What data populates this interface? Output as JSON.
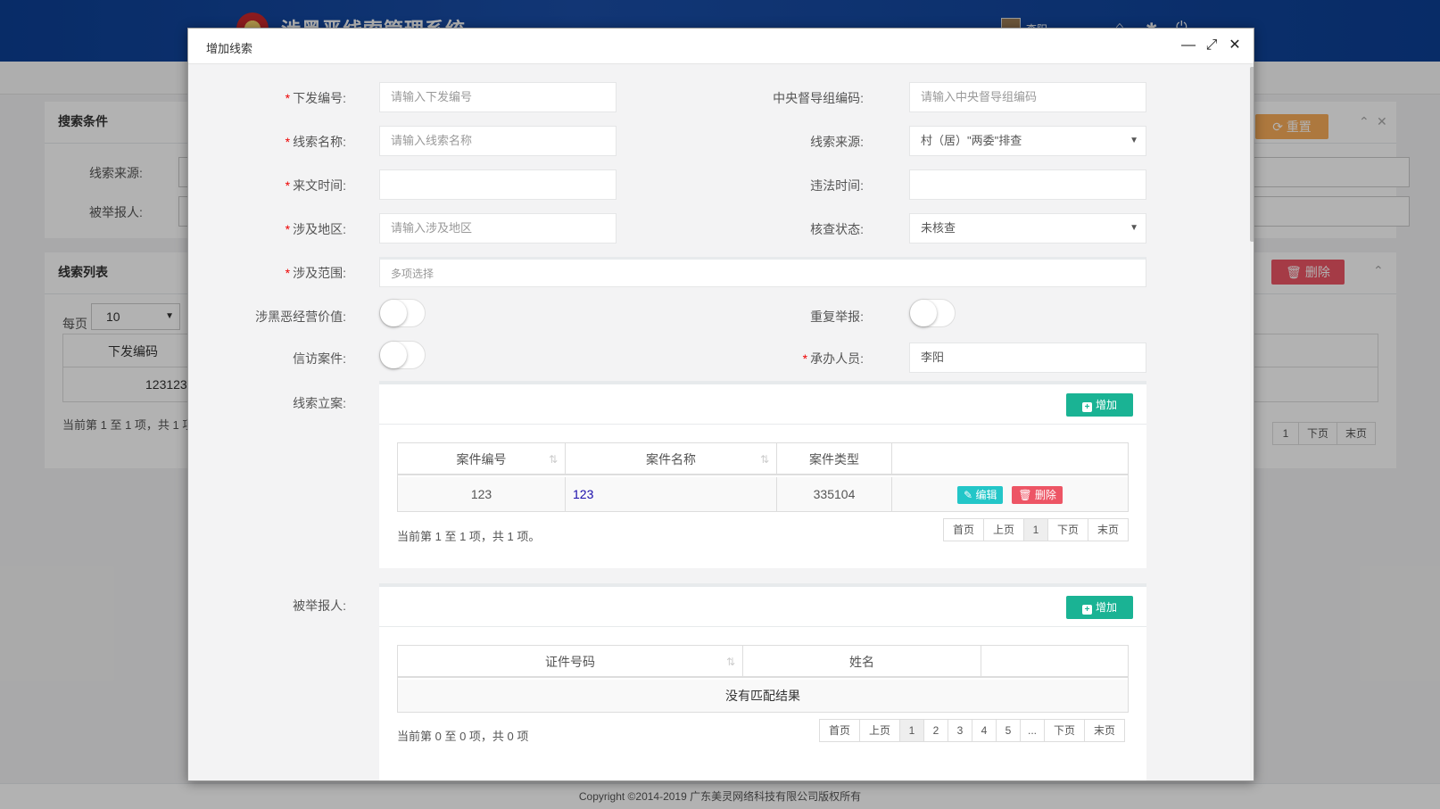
{
  "app": {
    "title": "涉黑恶线索管理系统",
    "user_name": "李阳",
    "copyright": "Copyright ©2014-2019 广东美灵网络科技有限公司版权所有"
  },
  "search_panel": {
    "title": "搜索条件",
    "label_source": "线索来源:",
    "label_reported": "被举报人:",
    "reset_label": "重置"
  },
  "list_panel": {
    "title": "线索列表",
    "per_page_label": "每页",
    "per_page_value": "10",
    "col_issue_no": "下发编码",
    "row_issue_no": "123123",
    "summary": "当前第 1 至 1 项，共 1 项。",
    "delete_label": "删除",
    "pager": {
      "page": "1",
      "next": "下页",
      "last": "末页"
    }
  },
  "modal": {
    "title": "增加线索",
    "fields": {
      "issue_no": {
        "label": "下发编号:",
        "placeholder": "请输入下发编号"
      },
      "central_code": {
        "label": "中央督导组编码:",
        "placeholder": "请输入中央督导组编码"
      },
      "clue_name": {
        "label": "线索名称:",
        "placeholder": "请输入线索名称"
      },
      "clue_source": {
        "label": "线索来源:",
        "value": "村（居）\"两委\"排查"
      },
      "doc_time": {
        "label": "来文时间:",
        "value": ""
      },
      "violation_time": {
        "label": "违法时间:",
        "value": ""
      },
      "region": {
        "label": "涉及地区:",
        "placeholder": "请输入涉及地区"
      },
      "check_status": {
        "label": "核查状态:",
        "value": "未核查"
      },
      "scope": {
        "label": "涉及范围:",
        "placeholder": "多项选择"
      },
      "gang_value": {
        "label": "涉黑恶经营价值:",
        "on": false
      },
      "repeat_report": {
        "label": "重复举报:",
        "on": false
      },
      "petition_case": {
        "label": "信访案件:",
        "on": false
      },
      "handler": {
        "label": "承办人员:",
        "value": "李阳"
      }
    },
    "case_section": {
      "label": "线索立案:",
      "add_label": "增加",
      "columns": [
        "案件编号",
        "案件名称",
        "案件类型",
        ""
      ],
      "rows": [
        {
          "case_no": "123",
          "case_name": "123",
          "case_type": "335104",
          "edit_label": "编辑",
          "delete_label": "删除"
        }
      ],
      "summary": "当前第 1 至 1 项，共 1 项。",
      "pager": [
        "首页",
        "上页",
        "1",
        "下页",
        "末页"
      ],
      "active_page": "1"
    },
    "reported_section": {
      "label": "被举报人:",
      "add_label": "增加",
      "columns": [
        "证件号码",
        "姓名",
        ""
      ],
      "empty_text": "没有匹配结果",
      "summary": "当前第 0 至 0 项，共 0 项",
      "pager": [
        "首页",
        "上页",
        "1",
        "2",
        "3",
        "4",
        "5",
        "...",
        "下页",
        "末页"
      ],
      "active_page": "1"
    }
  },
  "colors": {
    "header_blue": "#0c3f94",
    "primary_green": "#1ab394",
    "edit_cyan": "#23c6c8",
    "delete_red": "#ed5565",
    "reset_orange": "#f8ac59",
    "required_red": "#e00000"
  },
  "icons": {
    "minimize": "minimize-icon",
    "maximize": "maximize-icon",
    "close": "close-icon",
    "sort": "sort-icon",
    "plus": "plus-square-icon",
    "edit": "edit-icon",
    "trash": "trash-icon",
    "refresh": "refresh-icon",
    "chevron_up": "chevron-up-icon",
    "chevron_down": "chevron-down-icon"
  }
}
